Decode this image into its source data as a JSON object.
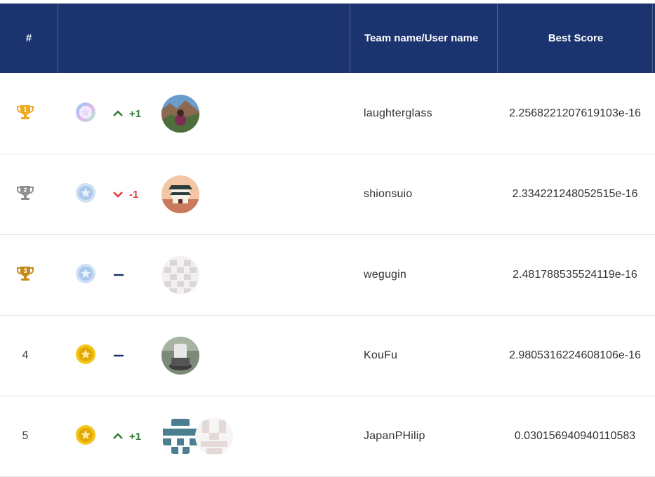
{
  "header": {
    "rank_label": "#",
    "team_label": "Team name/User name",
    "score_label": "Best Score"
  },
  "rows": [
    {
      "rank": "1",
      "rank_icon": "gold-trophy-icon",
      "tier_icon": "platinum-medal-icon",
      "delta_dir": "up",
      "delta": "+1",
      "avatar": "landscape-photo-avatar",
      "name": "laughterglass",
      "score": "2.2568221207619103e-16"
    },
    {
      "rank": "2",
      "rank_icon": "silver-trophy-icon",
      "tier_icon": "silver-medal-icon",
      "delta_dir": "down",
      "delta": "-1",
      "avatar": "temple-avatar",
      "name": "shionsuio",
      "score": "2.334221248052515e-16"
    },
    {
      "rank": "3",
      "rank_icon": "bronze-trophy-icon",
      "tier_icon": "silver-medal-icon",
      "delta_dir": "none",
      "delta": "",
      "avatar": "identicon-avatar",
      "name": "wegugin",
      "score": "2.481788535524119e-16"
    },
    {
      "rank": "4",
      "rank_icon": "",
      "tier_icon": "gold-medal-icon",
      "delta_dir": "none",
      "delta": "",
      "avatar": "photo-avatar",
      "name": "KouFu",
      "score": "2.9805316224608106e-16"
    },
    {
      "rank": "5",
      "rank_icon": "",
      "tier_icon": "gold-medal-icon",
      "delta_dir": "up",
      "delta": "+1",
      "avatar": "identicon-team-avatar",
      "name": "JapanPHilip",
      "score": "0.030156940940110583"
    }
  ],
  "colors": {
    "header_bg": "#1b336e",
    "gold": "#f0a81c",
    "silver": "#8f8f8f",
    "bronze": "#c58a16",
    "up": "#2e7d32",
    "down": "#e53935"
  }
}
